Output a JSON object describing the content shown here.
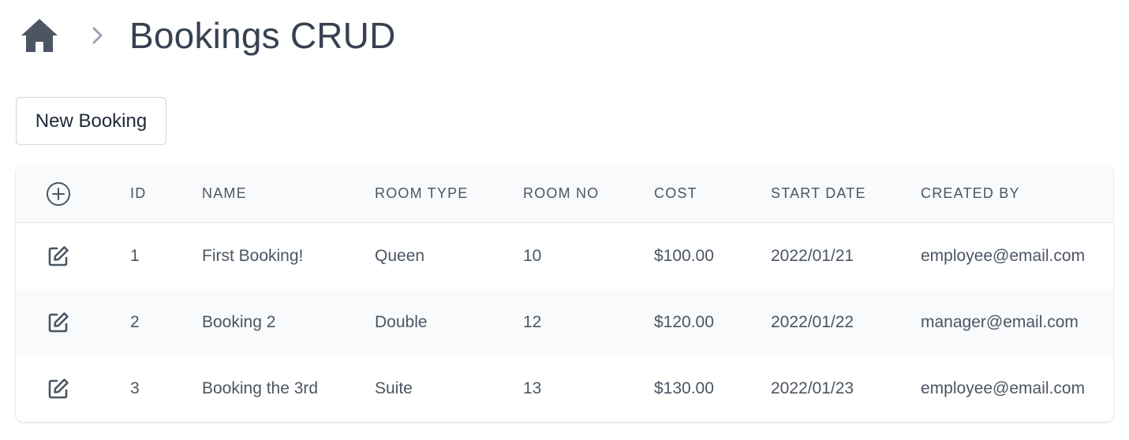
{
  "header": {
    "title": "Bookings CRUD"
  },
  "toolbar": {
    "new_booking_label": "New Booking"
  },
  "table": {
    "columns": [
      "ID",
      "NAME",
      "ROOM TYPE",
      "ROOM NO",
      "COST",
      "START DATE",
      "CREATED BY"
    ],
    "rows": [
      {
        "id": "1",
        "name": "First Booking!",
        "room_type": "Queen",
        "room_no": "10",
        "cost": "$100.00",
        "start_date": "2022/01/21",
        "created_by": "employee@email.com"
      },
      {
        "id": "2",
        "name": "Booking 2",
        "room_type": "Double",
        "room_no": "12",
        "cost": "$120.00",
        "start_date": "2022/01/22",
        "created_by": "manager@email.com"
      },
      {
        "id": "3",
        "name": "Booking the 3rd",
        "room_type": "Suite",
        "room_no": "13",
        "cost": "$130.00",
        "start_date": "2022/01/23",
        "created_by": "employee@email.com"
      }
    ]
  },
  "icons": {
    "home": "home-icon",
    "breadcrumb_separator": "chevron-right-icon",
    "add": "plus-circle-icon",
    "edit": "edit-icon"
  },
  "colors": {
    "text_primary": "#374151",
    "text_secondary": "#4b5563",
    "header_background": "#f9fafb",
    "stripe_background": "#f9fafb",
    "border": "#e5e7eb",
    "chevron": "#9ca3af"
  }
}
